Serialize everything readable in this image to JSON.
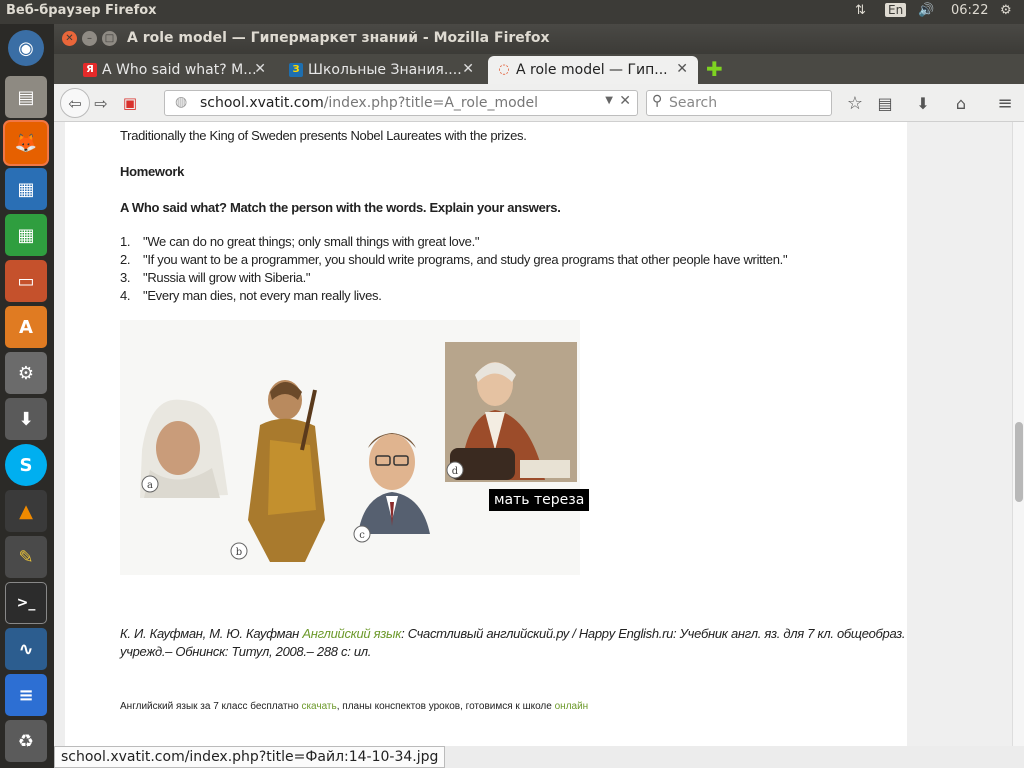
{
  "top_panel": {
    "app_title": "Веб-браузер Firefox",
    "lang": "En",
    "time": "06:22"
  },
  "window": {
    "title": "A role model — Гипермаркет знаний - Mozilla Firefox"
  },
  "tabs": [
    {
      "label": "A Who said what? M...",
      "favicon": "Я",
      "favicon_color": "#ffffff",
      "favicon_bg": "#e62a2a",
      "active": false
    },
    {
      "label": "Школьные Знания....",
      "favicon": "З",
      "favicon_color": "#ffd800",
      "favicon_bg": "#1e6fb0",
      "active": false
    },
    {
      "label": "A role model — Гип...",
      "favicon": "◌",
      "favicon_color": "#e2542a",
      "favicon_bg": "#f0f0ef",
      "active": true
    }
  ],
  "navbar": {
    "url_domain": "school.xvatit.com",
    "url_path": "/index.php?title=A_role_model",
    "search_placeholder": "Search"
  },
  "page": {
    "intro": "Traditionally the King of Sweden presents Nobel Laureates with the prizes.",
    "homework_heading": "Homework",
    "task_heading": "A Who said what? Match the person with the words. Explain your answers.",
    "quotes": [
      {
        "num": "1.",
        "text": "\"We can do no great things; only small things with great love.\""
      },
      {
        "num": "2.",
        "text": "\"If you want to be a programmer, you should write programs, and study grea programs that other people have written.\""
      },
      {
        "num": "3.",
        "text": "\"Russia will grow with Siberia.\""
      },
      {
        "num": "4.",
        "text": "\"Every man dies, not every man really lives."
      }
    ],
    "image_labels": {
      "a": "a",
      "b": "b",
      "c": "c",
      "d": "d"
    },
    "tooltip": "мать тереза",
    "citation_authors": "К. И. Кауфман, М. Ю. Кауфман ",
    "citation_link": "Английский язык",
    "citation_rest": ": Счастливый английский.ру / Happy English.ru: Учебник англ. яз. для 7 кл. общеобраз.",
    "citation_line2": "учрежд.– Обнинск: Титул, 2008.– 288 с: ил.",
    "footer_text1": "Английский язык за 7 класс бесплатно ",
    "footer_link1": "скачать",
    "footer_text2": ", планы конспектов уроков, готовимся к школе ",
    "footer_link2": "онлайн"
  },
  "statusbar": {
    "text": "school.xvatit.com/index.php?title=Файл:14-10-34.jpg"
  }
}
